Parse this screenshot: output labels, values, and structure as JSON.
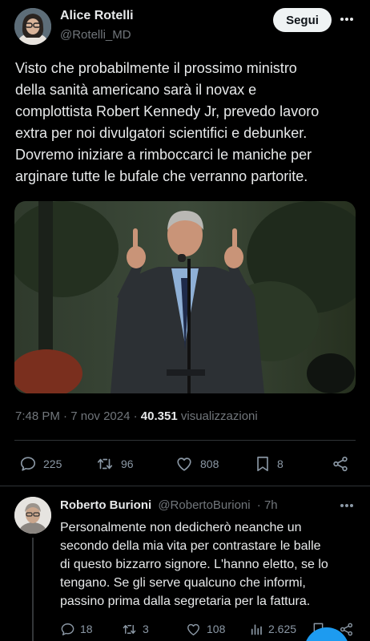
{
  "post": {
    "author": {
      "name": "Alice Rotelli",
      "handle": "@Rotelli_MD"
    },
    "follow_label": "Segui",
    "text_lines": [
      "Visto che probabilmente il prossimo ministro",
      "della sanità americano sarà il novax e",
      "complottista Robert Kennedy Jr, prevedo lavoro",
      "extra per noi divulgatori scientifici e debunker.",
      "Dovremo iniziare a rimboccarci le maniche per",
      "arginare tutte le bufale che verranno partorite."
    ],
    "meta": {
      "time": "7:48 PM",
      "date": "7 nov 2024",
      "views_count": "40.351",
      "views_label": "visualizzazioni"
    },
    "stats": {
      "replies": "225",
      "reposts": "96",
      "likes": "808",
      "bookmarks": "8"
    }
  },
  "reply": {
    "author": {
      "name": "Roberto Burioni",
      "handle": "@RobertoBurioni",
      "age": "· 7h"
    },
    "text_lines": [
      "Personalmente non dedicherò neanche un",
      "secondo della mia vita per contrastare le balle",
      "di questo bizzarro signore. L'hanno eletto, se lo",
      "tengano. Se gli serve qualcuno che informi,",
      "passino prima dalla segretaria per la fattura."
    ],
    "stats": {
      "replies": "18",
      "reposts": "3",
      "likes": "108",
      "views": "2.625"
    }
  },
  "colors": {
    "background": "#000000",
    "text": "#e7e9ea",
    "muted": "#71767b",
    "accent": "#1d9bf0",
    "divider": "#2f3336"
  },
  "icons": [
    "more-icon",
    "reply-icon",
    "repost-icon",
    "like-icon",
    "bookmark-icon",
    "share-icon",
    "views-icon"
  ]
}
